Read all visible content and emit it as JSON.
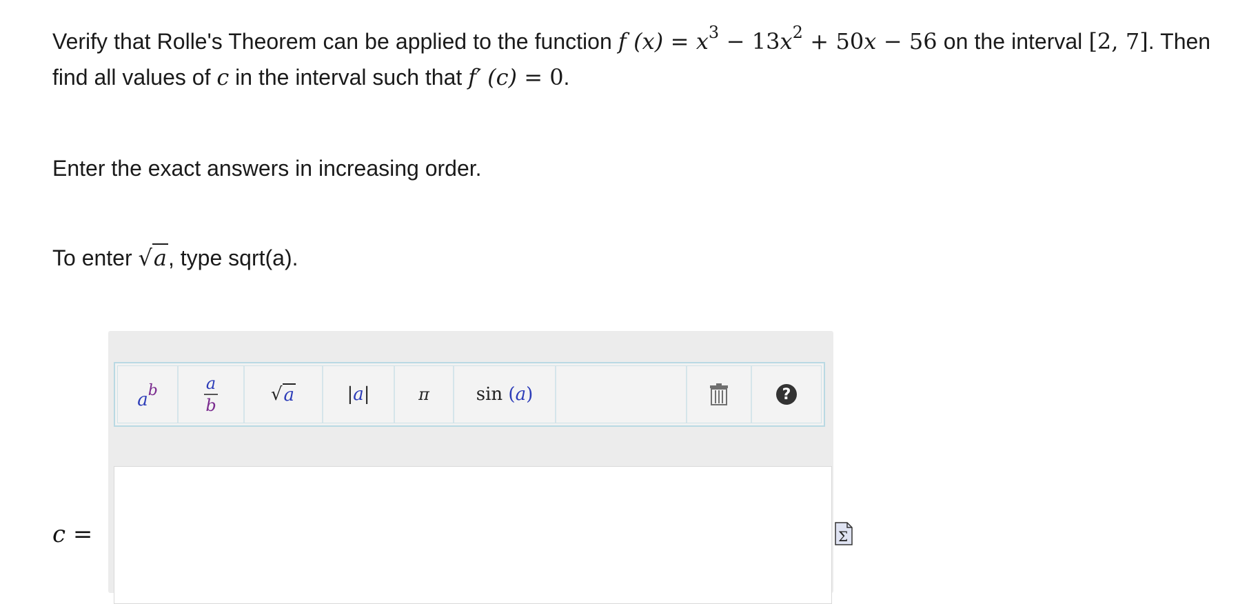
{
  "question": {
    "p1_a": "Verify that Rolle's Theorem can be applied to the function ",
    "f_lhs": "f",
    "f_arg": "(x)",
    "eq": " = ",
    "x": "x",
    "exp3": "3",
    "term2_coef": " − 13",
    "exp2": "2",
    "term3": " + 50",
    "term4": " − 56",
    "p1_b": " on the interval",
    "interval": "[2, 7]",
    "p1_c": ". Then find all values of ",
    "c": "c",
    "p1_d": " in the interval such that ",
    "fprime": "f′",
    "c_arg": "(c)",
    "zero": " = 0",
    "p1_e": "."
  },
  "instruction1": "Enter the exact answers in increasing order.",
  "instruction2": {
    "pre": "To enter ",
    "radicand": "a",
    "post": ", type sqrt(a)."
  },
  "toolbar": {
    "power_base": "a",
    "power_exp": "b",
    "frac_num": "a",
    "frac_den": "b",
    "sqrt_sym": "√",
    "sqrt_arg": "a",
    "abs_bar": "|",
    "abs_arg": "a",
    "pi": "π",
    "sin_fn": "sin",
    "sin_lparen": "(",
    "sin_arg": "a",
    "sin_rparen": ")",
    "help": "?"
  },
  "answer": {
    "var": "c",
    "eq": " =",
    "value": ""
  },
  "icons": {
    "trash": "trash-icon",
    "help": "help-icon",
    "sigma": "sigma-icon"
  },
  "colors": {
    "blue_var": "#2c3cb8",
    "purple_var": "#7a2a8e",
    "toolbar_border": "#b9d9e3",
    "editor_bg": "#ececec"
  }
}
